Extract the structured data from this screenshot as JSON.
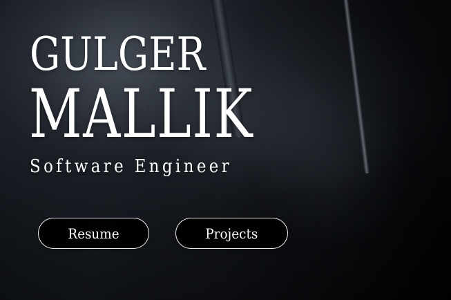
{
  "hero": {
    "first_name": "GULGER",
    "last_name": "MALLIK",
    "role": "Software Engineer",
    "buttons": {
      "resume": "Resume",
      "projects": "Projects"
    },
    "colors": {
      "text": "#ffffff",
      "button_background": "#000000",
      "button_border": "#ffffff",
      "background_dark": "#050608"
    }
  }
}
